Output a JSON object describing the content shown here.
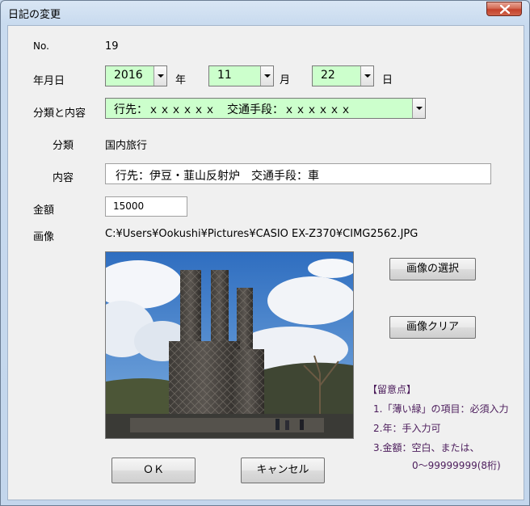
{
  "window": {
    "title": "日記の変更",
    "close_icon": "close-icon"
  },
  "form": {
    "no_label": "No.",
    "no_value": "19",
    "date_label": "年月日",
    "year_value": "2016",
    "year_unit": "年",
    "month_value": "11",
    "month_unit": "月",
    "day_value": "22",
    "day_unit": "日",
    "category_content_label": "分類と内容",
    "category_content_value": "行先：ｘｘｘｘｘｘ　交通手段：ｘｘｘｘｘｘ",
    "category_label": "分類",
    "category_value": "国内旅行",
    "content_label": "内容",
    "content_value": "行先：伊豆・韮山反射炉　交通手段：車",
    "amount_label": "金額",
    "amount_value": "15000",
    "image_label": "画像",
    "image_path": "C:¥Users¥Ookushi¥Pictures¥CASIO EX-Z370¥CIMG2562.JPG"
  },
  "buttons": {
    "select_image": "画像の選択",
    "clear_image": "画像クリア",
    "ok": "ＯＫ",
    "cancel": "キャンセル"
  },
  "notes": {
    "heading": "【留意点】",
    "items": [
      "1.「薄い緑」の項目：必須入力",
      "2.年：手入力可",
      "3.金額：空白、または、",
      "0～99999999(8桁)"
    ]
  },
  "colors": {
    "required_field": "#ccffcc",
    "note_text": "#4b1c5b",
    "close_button": "#c4412a"
  }
}
